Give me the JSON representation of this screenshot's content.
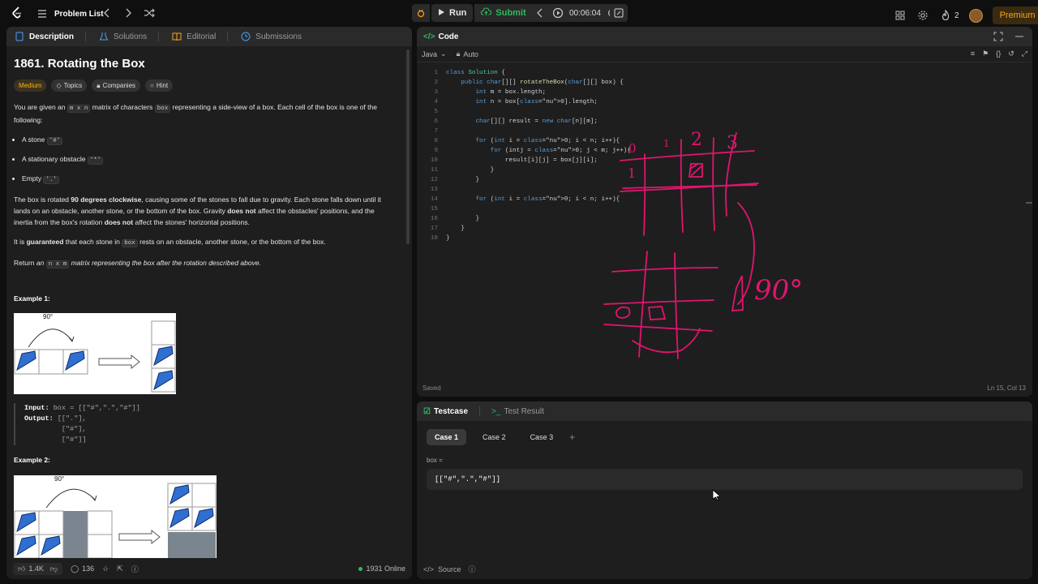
{
  "topbar": {
    "problem_list": "Problem List",
    "run": "Run",
    "submit": "Submit",
    "timer": "00:06:04",
    "streak": "2",
    "premium": "Premium"
  },
  "left_tabs": [
    "Description",
    "Solutions",
    "Editorial",
    "Submissions"
  ],
  "problem": {
    "title": "1861. Rotating the Box",
    "difficulty": "Medium",
    "chips": [
      "Topics",
      "Companies",
      "Hint"
    ],
    "p1_a": "You are given an ",
    "p1_code": "m x n",
    "p1_b": " matrix of characters ",
    "p1_code2": "box",
    "p1_c": " representing a side-view of a box. Each cell of the box is one of the following:",
    "bullets": [
      {
        "label": "A stone ",
        "code": "'#'"
      },
      {
        "label": "A stationary obstacle ",
        "code": "'*'"
      },
      {
        "label": "Empty ",
        "code": "'.'"
      }
    ],
    "p2_a": "The box is rotated ",
    "p2_b": "90 degrees clockwise",
    "p2_c": ", causing some of the stones to fall due to gravity. Each stone falls down until it lands on an obstacle, another stone, or the bottom of the box. Gravity ",
    "p2_d": "does not",
    "p2_e": " affect the obstacles' positions, and the inertia from the box's rotation ",
    "p2_f": "does not",
    "p2_g": " affect the stones' horizontal positions.",
    "p3_a": "It is ",
    "p3_b": "guaranteed",
    "p3_c": " that each stone in ",
    "p3_code": "box",
    "p3_d": " rests on an obstacle, another stone, or the bottom of the box.",
    "p4_a": "Return ",
    "p4_b": "an ",
    "p4_code": "n x m",
    "p4_c": " matrix representing the box after the rotation described above.",
    "example1": "Example 1:",
    "example2": "Example 2:",
    "img_angle": "90°",
    "ex1_input_label": "Input:",
    "ex1_input": " box = [[\"#\",\".\",\"#\"]]",
    "ex1_output_label": "Output:",
    "ex1_output": " [[\".\"],\n         [\"#\"],\n         [\"#\"]]"
  },
  "left_footer": {
    "likes": "1.4K",
    "comments": "136",
    "online": "1931 Online"
  },
  "code_panel": {
    "title": "Code",
    "language": "Java",
    "mode": "Auto",
    "status_saved": "Saved",
    "cursor": "Ln 15, Col 13"
  },
  "code_lines": [
    "class Solution {",
    "    public char[][] rotateTheBox(char[][] box) {",
    "        int m = box.length;",
    "        int n = box[0].length;",
    "",
    "        char[][] result = new char[n][m];",
    "",
    "        for (int i = 0; i < n; i++){",
    "            for (intj = 0; j < m; j++){",
    "                result[i][j] = box[j][i];",
    "            }",
    "        }",
    "",
    "        for (int i = 0; i < n; i++){",
    "",
    "        }",
    "    }",
    "}"
  ],
  "annotations": {
    "col_labels": [
      "0",
      "1",
      "2",
      "3"
    ],
    "row_label": "1",
    "deg": "90°"
  },
  "testcase": {
    "tab": "Testcase",
    "result_tab": "Test Result",
    "cases": [
      "Case 1",
      "Case 2",
      "Case 3"
    ],
    "var_label": "box =",
    "var_value": "[[\"#\",\".\",\"#\"]]",
    "source": "Source"
  },
  "colors": {
    "accent_green": "#2cbb5d",
    "medium": "#ffb700",
    "premium": "#ffa116",
    "ink": "#e0156e"
  }
}
